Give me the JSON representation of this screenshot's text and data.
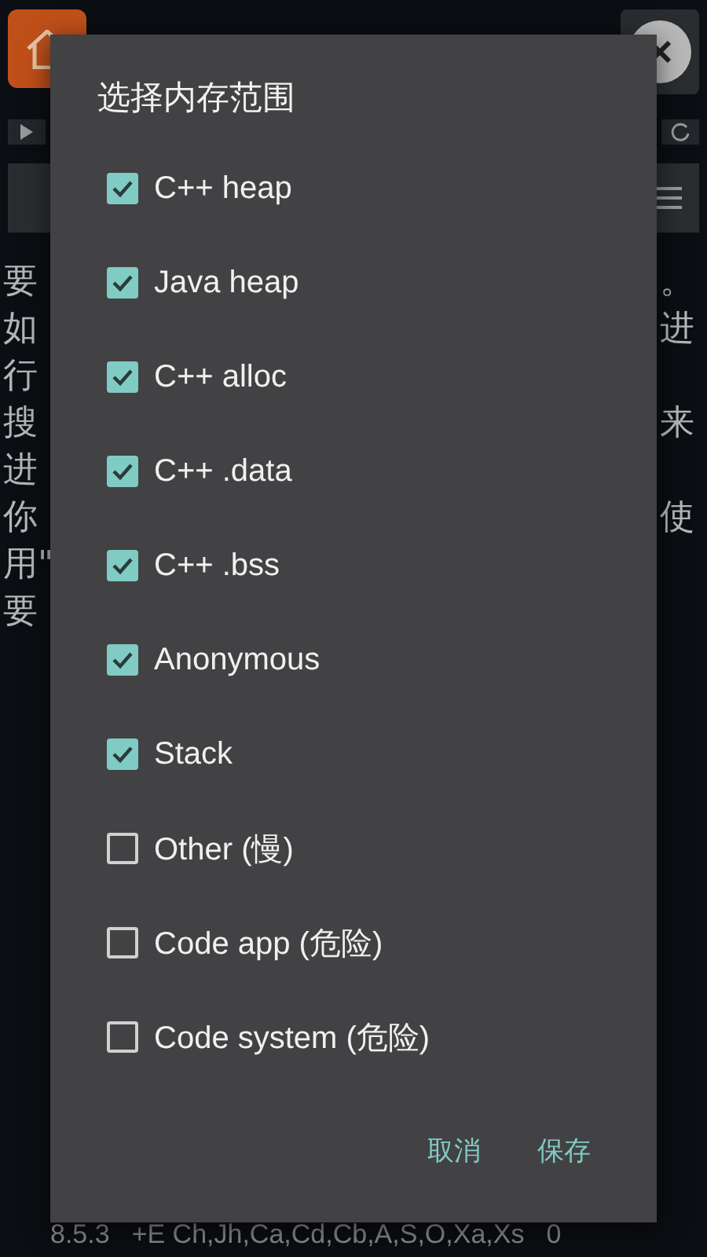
{
  "background": {
    "lines": [
      {
        "left": "要",
        "right": "。"
      },
      {
        "left": "如",
        "right": "进"
      },
      {
        "left": "行"
      },
      {
        "left": "搜",
        "right": "来"
      },
      {
        "left": "进"
      },
      {
        "left": "你",
        "right": "使"
      },
      {
        "left": "用\""
      },
      {
        "left": "要"
      }
    ],
    "status_bar": {
      "version": "8.5.3",
      "regions": "+E Ch,Jh,Ca,Cd,Cb,A,S,O,Xa,Xs",
      "count": "0"
    }
  },
  "dialog": {
    "title": "选择内存范围",
    "options": [
      {
        "label": "C++ heap",
        "checked": true
      },
      {
        "label": "Java heap",
        "checked": true
      },
      {
        "label": "C++ alloc",
        "checked": true
      },
      {
        "label": "C++ .data",
        "checked": true
      },
      {
        "label": "C++ .bss",
        "checked": true
      },
      {
        "label": "Anonymous",
        "checked": true
      },
      {
        "label": "Stack",
        "checked": true
      },
      {
        "label": "Other (慢)",
        "checked": false
      },
      {
        "label": "Code app (危险)",
        "checked": false
      },
      {
        "label": "Code system (危险)",
        "checked": false
      }
    ],
    "buttons": [
      "取消",
      "保存"
    ]
  }
}
